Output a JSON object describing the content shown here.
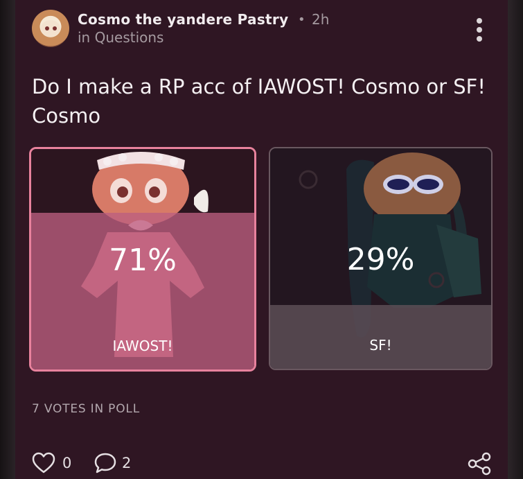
{
  "post": {
    "author": "Cosmo the yandere Pastry",
    "separator": "•",
    "time": "2h",
    "category": "in Questions",
    "question": "Do I make a RP acc of IAWOST! Cosmo or SF! Cosmo"
  },
  "poll": {
    "options": [
      {
        "label": "IAWOST!",
        "percent_text": "71%",
        "percent": 71,
        "selected": true
      },
      {
        "label": "SF!",
        "percent_text": "29%",
        "percent": 29,
        "selected": false
      }
    ],
    "votes_text": "7 VOTES IN POLL"
  },
  "footer": {
    "like_count": "0",
    "comment_count": "2"
  },
  "colors": {
    "card_bg": "#2f1623",
    "selected_border": "#e8829d",
    "selected_fill": "#bc5f80",
    "unselected_fill": "#5c4e56"
  },
  "icons": [
    "avatar",
    "more-vertical-icon",
    "heart-icon",
    "comment-icon",
    "share-icon"
  ]
}
